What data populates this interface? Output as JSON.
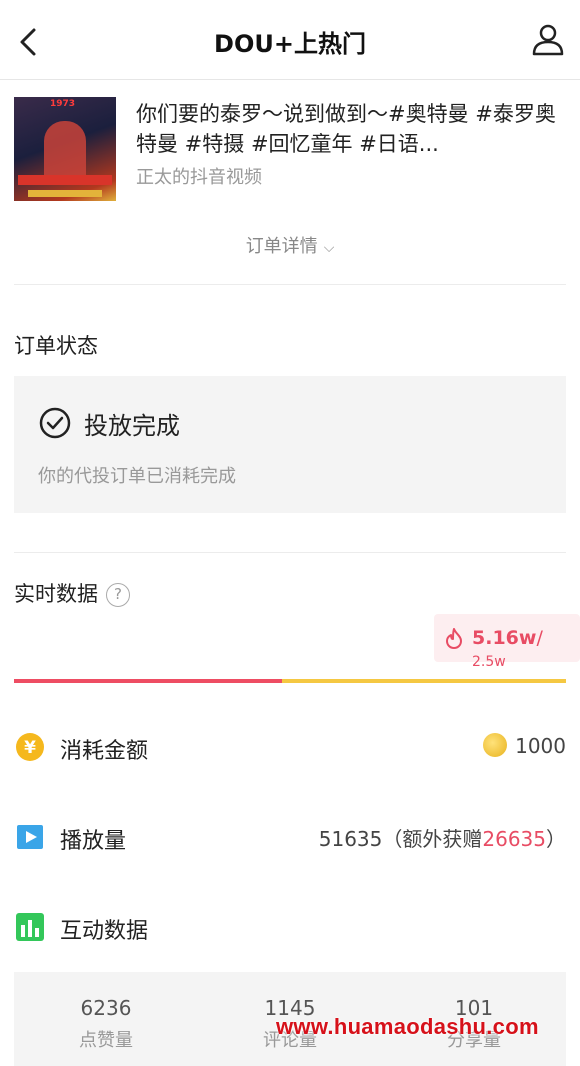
{
  "header": {
    "title": "DOU+上热门"
  },
  "video": {
    "title": "你们要的泰罗～说到做到～#奥特曼 #泰罗奥特曼 #特摄 #回忆童年 #日语...",
    "author": "正太的抖音视频",
    "thumb_text": "1973"
  },
  "order": {
    "detail_label": "订单详情"
  },
  "status": {
    "section_label": "订单状态",
    "title": "投放完成",
    "description": "你的代投订单已消耗完成"
  },
  "realtime": {
    "section_label": "实时数据",
    "help_glyph": "?",
    "current": "5.16w",
    "separator": "/",
    "target": "2.5w",
    "progress_fraction": 0.485
  },
  "metrics": {
    "spend": {
      "label": "消耗金额",
      "value": "1000",
      "icon": "yen-coin-icon",
      "color": "#f5b81d"
    },
    "plays": {
      "label": "播放量",
      "value": "51635",
      "extra_prefix": "（额外获赠",
      "extra_value": "26635",
      "extra_suffix": "）",
      "icon": "play-icon",
      "color": "#3aa5e8"
    },
    "interaction": {
      "label": "互动数据",
      "icon": "bar-chart-icon",
      "color": "#33c75a"
    }
  },
  "stats": [
    {
      "value": "6236",
      "label": "点赞量"
    },
    {
      "value": "1145",
      "label": "评论量"
    },
    {
      "value": "101",
      "label": "分享量"
    }
  ],
  "watermark": "www.huamaodashu.com",
  "colors": {
    "accent_red": "#e84c64",
    "progress_yellow": "#f5c842"
  }
}
